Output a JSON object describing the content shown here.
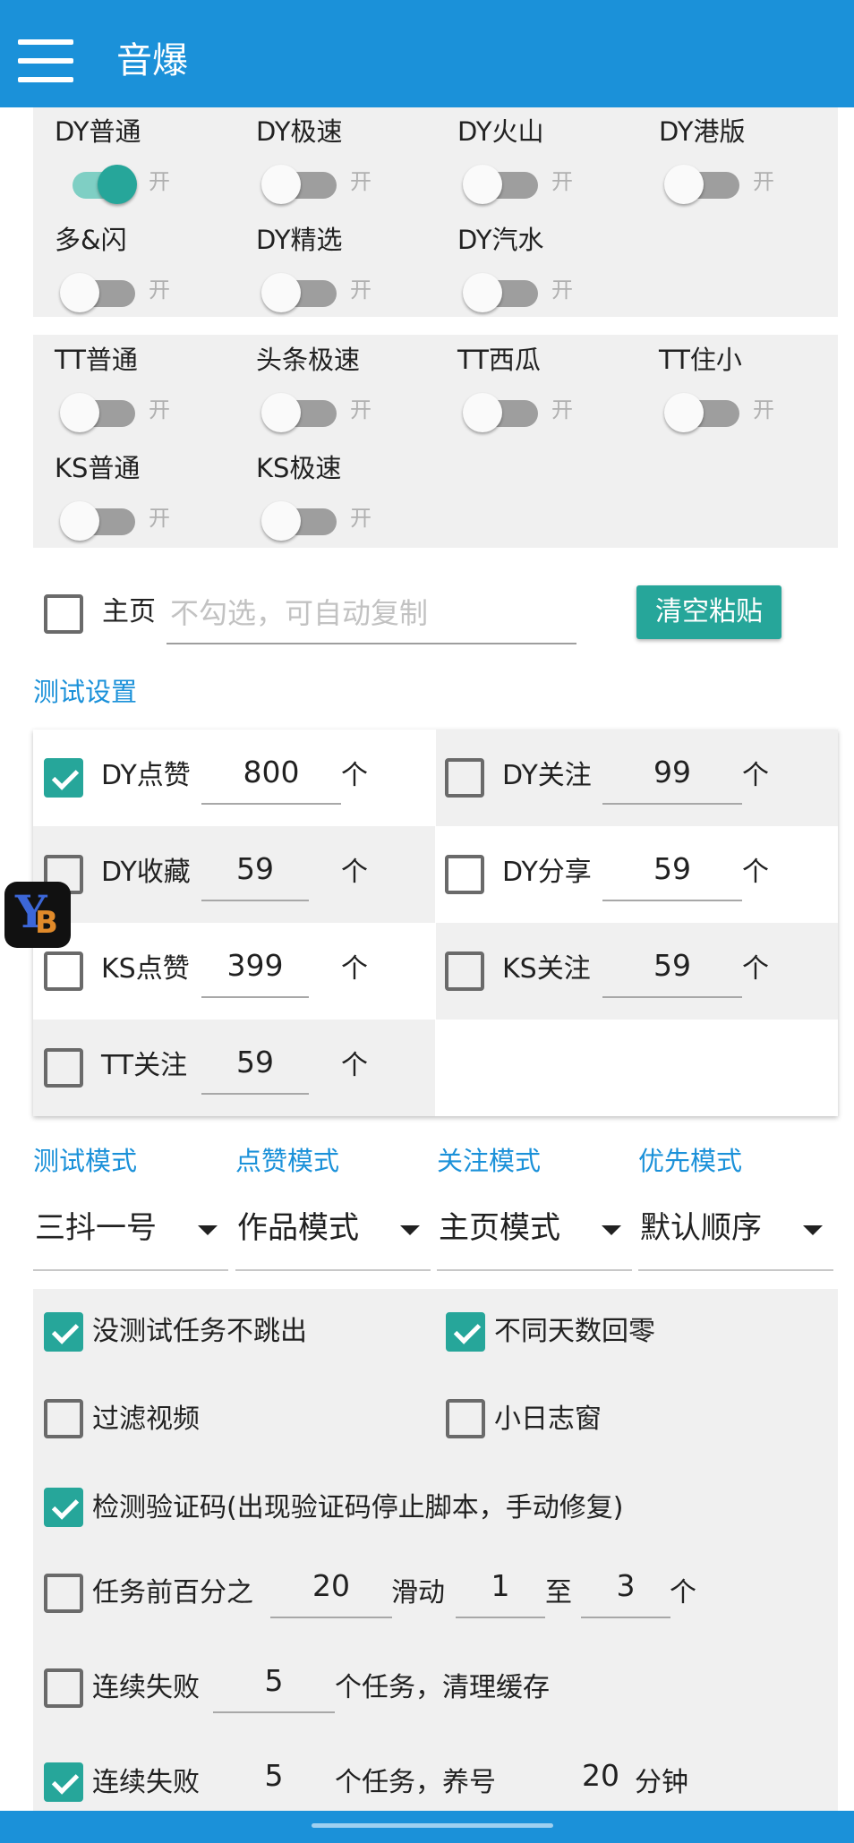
{
  "app_bar": {
    "title": "音爆"
  },
  "switch_groups": [
    [
      {
        "label": "DY普通",
        "on": true
      },
      {
        "label": "DY极速",
        "on": false
      },
      {
        "label": "DY火山",
        "on": false
      },
      {
        "label": "DY港版",
        "on": false
      },
      {
        "label": "多&闪",
        "on": false
      },
      {
        "label": "DY精选",
        "on": false
      },
      {
        "label": "DY汽水",
        "on": false
      }
    ],
    [
      {
        "label": "TT普通",
        "on": false
      },
      {
        "label": "头条极速",
        "on": false
      },
      {
        "label": "TT西瓜",
        "on": false
      },
      {
        "label": "TT住小",
        "on": false
      },
      {
        "label": "KS普通",
        "on": false
      },
      {
        "label": "KS极速",
        "on": false
      }
    ]
  ],
  "switch_on_text": "开",
  "homepage": {
    "label": "主页",
    "placeholder": "不勾选，可自动复制",
    "checked": false
  },
  "clear_button": "清空粘贴",
  "test_settings": {
    "title": "测试设置",
    "unit": "个",
    "items": [
      {
        "label": "DY点赞",
        "value": "800",
        "checked": true
      },
      {
        "label": "DY关注",
        "value": "99",
        "checked": false
      },
      {
        "label": "DY收藏",
        "value": "59",
        "checked": false
      },
      {
        "label": "DY分享",
        "value": "59",
        "checked": false
      },
      {
        "label": "KS点赞",
        "value": "399",
        "checked": false
      },
      {
        "label": "KS关注",
        "value": "59",
        "checked": false
      },
      {
        "label": "TT关注",
        "value": "59",
        "checked": false
      }
    ]
  },
  "modes": [
    {
      "title": "测试模式",
      "value": "三抖一号"
    },
    {
      "title": "点赞模式",
      "value": "作品模式"
    },
    {
      "title": "关注模式",
      "value": "主页模式"
    },
    {
      "title": "优先模式",
      "value": "默认顺序"
    }
  ],
  "options": {
    "no_task_no_exit": {
      "label": "没测试任务不跳出",
      "checked": true
    },
    "reset_diff_days": {
      "label": "不同天数回零",
      "checked": true
    },
    "filter_video": {
      "label": "过滤视频",
      "checked": false
    },
    "small_log_window": {
      "label": "小日志窗",
      "checked": false
    },
    "detect_captcha": {
      "label": "检测验证码(出现验证码停止脚本，手动修复)",
      "checked": true
    },
    "swipe": {
      "checked": false,
      "label_a": "任务前百分之",
      "percent": "20",
      "label_b": "滑动",
      "min": "1",
      "label_c": "至",
      "max": "3",
      "label_d": "个"
    },
    "clear_cache": {
      "checked": false,
      "label_a": "连续失败",
      "count": "5",
      "label_b": "个任务，清理缓存"
    },
    "nurture": {
      "checked": true,
      "label_a": "连续失败",
      "count": "5",
      "label_b": "个任务，养号",
      "minutes": "20",
      "label_c": "分钟"
    }
  },
  "colors": {
    "primary": "#1b91d9",
    "accent": "#26a69a",
    "panel": "#f0f0f0"
  },
  "floating_logo": {
    "text_y": "Y",
    "text_b": "B"
  }
}
